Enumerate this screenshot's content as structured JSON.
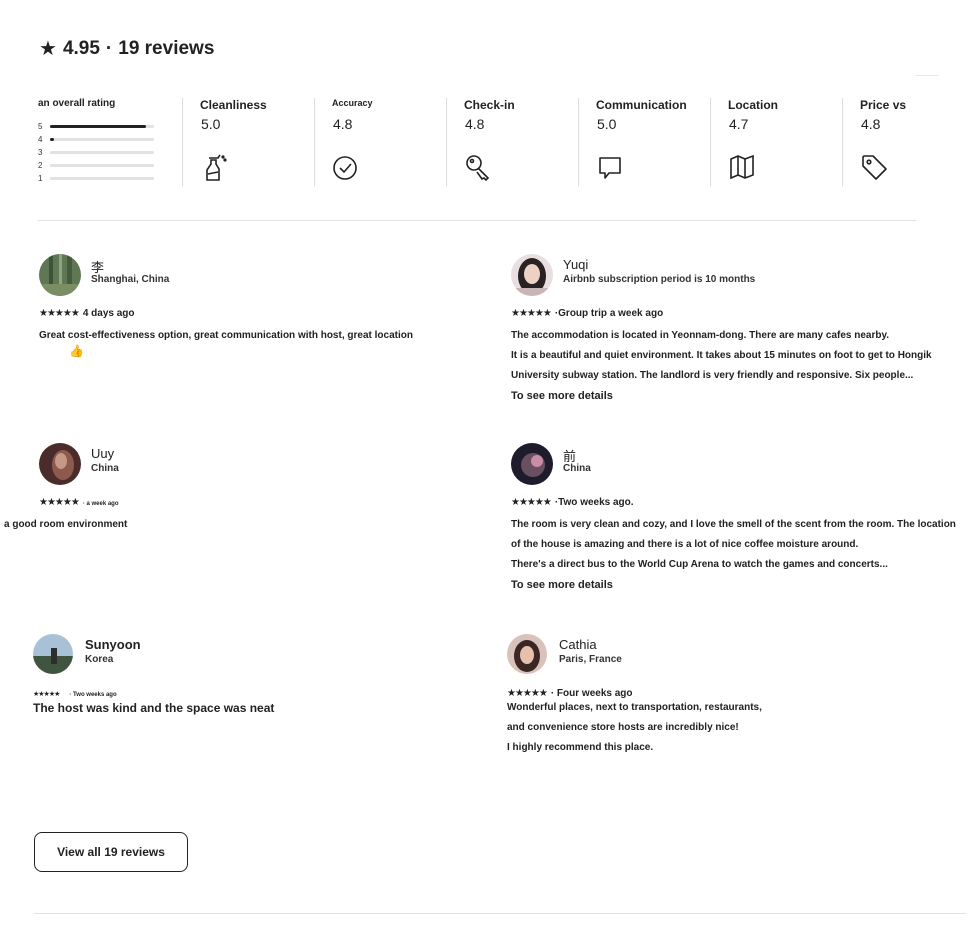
{
  "header": {
    "rating": "4.95",
    "separator": "·",
    "reviews_count": "19 reviews"
  },
  "overall": {
    "label": "an overall rating",
    "levels": [
      {
        "n": "5",
        "fraction": 0.92
      },
      {
        "n": "4",
        "fraction": 0.04
      },
      {
        "n": "3",
        "fraction": 0
      },
      {
        "n": "2",
        "fraction": 0
      },
      {
        "n": "1",
        "fraction": 0
      }
    ]
  },
  "categories": [
    {
      "label": "Cleanliness",
      "value": "5.0",
      "icon": "spray-bottle-icon"
    },
    {
      "label": "Accuracy",
      "value": "4.8",
      "icon": "check-circle-icon"
    },
    {
      "label": "Check-in",
      "value": "4.8",
      "icon": "key-icon"
    },
    {
      "label": "Communication",
      "value": "5.0",
      "icon": "chat-bubble-icon"
    },
    {
      "label": "Location",
      "value": "4.7",
      "icon": "map-icon"
    },
    {
      "label": "Price vs",
      "value": "4.8",
      "icon": "price-tag-icon"
    }
  ],
  "reviews": [
    {
      "name": "李",
      "location": "Shanghai, China",
      "stars": "★★★★★",
      "meta": "4 days ago",
      "lines": [
        "Great cost-effectiveness option, great communication with host, great location"
      ],
      "extra": "👍"
    },
    {
      "name": "Yuqi",
      "location": "Airbnb subscription period is 10 months",
      "stars": "★★★★★",
      "meta": "·Group trip a week ago",
      "lines": [
        "The accommodation is located in Yeonnam-dong. There are many cafes nearby.",
        "It is a beautiful and quiet environment. It takes about 15 minutes on foot to get to Hongik",
        "University subway station. The landlord is very friendly and responsive. Six people..."
      ],
      "more": "To see more details"
    },
    {
      "name": "Uuy",
      "location": "China",
      "stars": "★★★★★",
      "meta": "· a week ago",
      "lines": [
        "a good room environment"
      ]
    },
    {
      "name": "前",
      "location": "China",
      "stars": "★★★★★",
      "meta": "·Two weeks ago.",
      "lines": [
        "The room is very clean and cozy, and I love the smell of the scent from the room. The location",
        "of the house is amazing and there is a lot of nice coffee moisture around.",
        "There's a direct bus to the World Cup Arena to watch the games and concerts..."
      ],
      "more": "To see more details"
    },
    {
      "name": "Sunyoon",
      "location": "Korea",
      "stars": "★★★★★",
      "meta": "· Two weeks ago",
      "lines": [
        "The host was kind and the space was neat"
      ]
    },
    {
      "name": "Cathia",
      "location": "Paris, France",
      "stars": "★★★★★",
      "meta": "· Four weeks ago",
      "lines": [
        "Wonderful places, next to transportation, restaurants,",
        "and convenience store hosts are incredibly nice!",
        "I highly recommend this place."
      ]
    }
  ],
  "view_all_button": "View all 19 reviews",
  "colors": {
    "text": "#222222",
    "divider": "#dddddd",
    "bar_track": "#e2e2e2"
  }
}
